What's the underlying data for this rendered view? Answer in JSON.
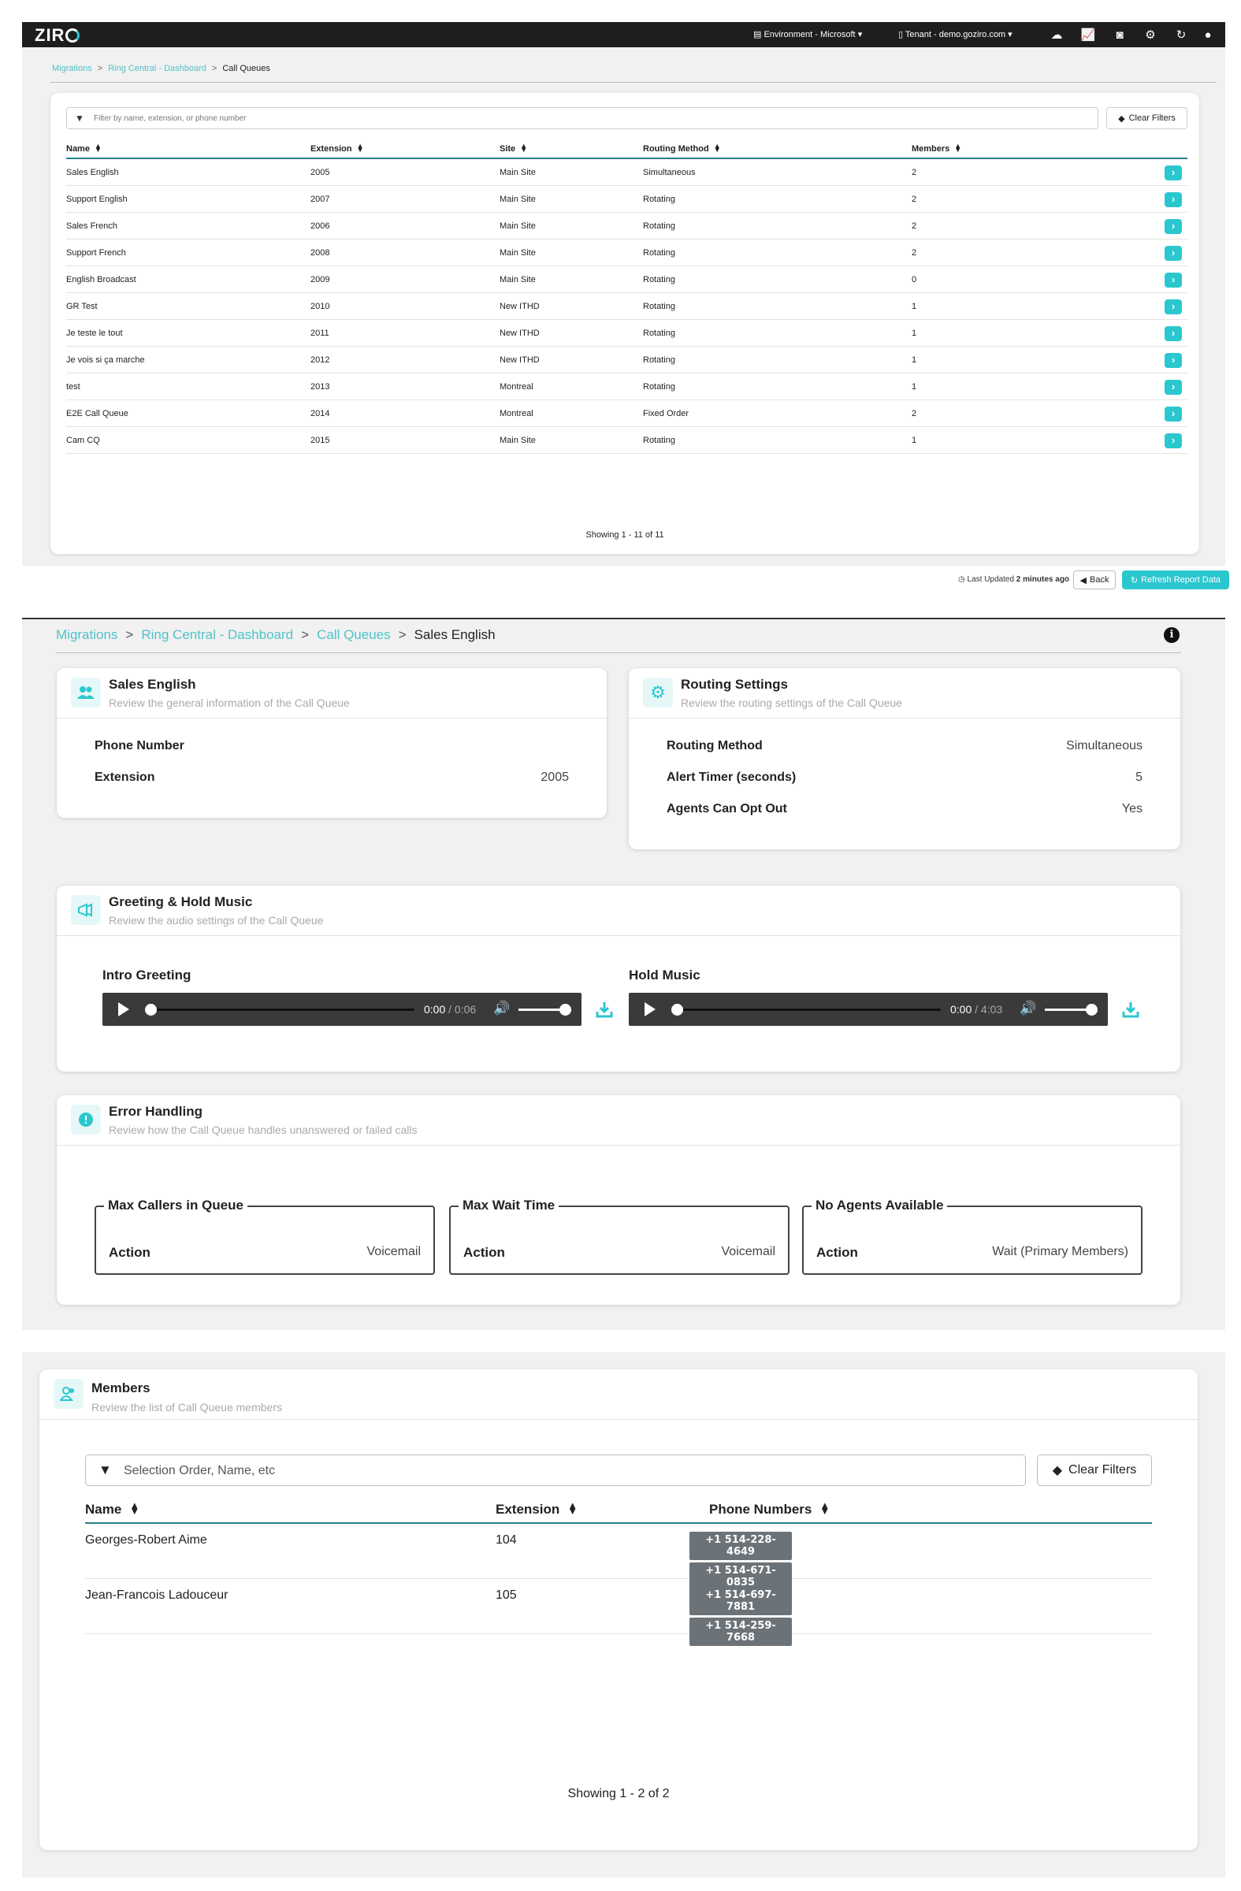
{
  "app": {
    "logo": "ZIR",
    "environment": "Environment - Microsoft",
    "tenant": "Tenant - demo.goziro.com"
  },
  "list_view": {
    "breadcrumb": [
      "Migrations",
      "Ring Central - Dashboard",
      "Call Queues"
    ],
    "filter_placeholder": "Filter by name, extension, or phone number",
    "clear_filters": "Clear Filters",
    "columns": [
      "Name",
      "Extension",
      "Site",
      "Routing Method",
      "Members"
    ],
    "rows": [
      [
        "Sales English",
        "2005",
        "Main Site",
        "Simultaneous",
        "2"
      ],
      [
        "Support English",
        "2007",
        "Main Site",
        "Rotating",
        "2"
      ],
      [
        "Sales French",
        "2006",
        "Main Site",
        "Rotating",
        "2"
      ],
      [
        "Support French",
        "2008",
        "Main Site",
        "Rotating",
        "2"
      ],
      [
        "English Broadcast",
        "2009",
        "Main Site",
        "Rotating",
        "0"
      ],
      [
        "GR Test",
        "2010",
        "New ITHD",
        "Rotating",
        "1"
      ],
      [
        "Je teste le tout",
        "2011",
        "New ITHD",
        "Rotating",
        "1"
      ],
      [
        "Je vois si ça marche",
        "2012",
        "New ITHD",
        "Rotating",
        "1"
      ],
      [
        "test",
        "2013",
        "Montreal",
        "Rotating",
        "1"
      ],
      [
        "E2E Call Queue",
        "2014",
        "Montreal",
        "Fixed Order",
        "2"
      ],
      [
        "Cam CQ",
        "2015",
        "Main Site",
        "Rotating",
        "1"
      ]
    ],
    "showing": "Showing 1 - 11 of 11",
    "last_updated_prefix": "Last Updated",
    "last_updated_value": "2 minutes ago",
    "back": "Back",
    "refresh": "Refresh Report Data"
  },
  "detail_view": {
    "breadcrumb": [
      "Migrations",
      "Ring Central - Dashboard",
      "Call Queues",
      "Sales English"
    ],
    "info_icon": "i",
    "general": {
      "title": "Sales English",
      "subtitle": "Review the general information of the Call Queue",
      "phone_label": "Phone Number",
      "phone_value": "",
      "extension_label": "Extension",
      "extension_value": "2005"
    },
    "routing": {
      "title": "Routing Settings",
      "subtitle": "Review the routing settings of the Call Queue",
      "method_label": "Routing Method",
      "method_value": "Simultaneous",
      "alert_label": "Alert Timer (seconds)",
      "alert_value": "5",
      "optout_label": "Agents Can Opt Out",
      "optout_value": "Yes"
    },
    "audio": {
      "title": "Greeting & Hold Music",
      "subtitle": "Review the audio settings of the Call Queue",
      "intro_label": "Intro Greeting",
      "intro_time": "0:00",
      "intro_duration": "0:06",
      "hold_label": "Hold Music",
      "hold_time": "0:00",
      "hold_duration": "4:03"
    },
    "errors": {
      "title": "Error Handling",
      "subtitle": "Review how the Call Queue handles unanswered or failed calls",
      "boxes": [
        {
          "legend": "Max Callers in Queue",
          "action_label": "Action",
          "action_value": "Voicemail"
        },
        {
          "legend": "Max Wait Time",
          "action_label": "Action",
          "action_value": "Voicemail"
        },
        {
          "legend": "No Agents Available",
          "action_label": "Action",
          "action_value": "Wait (Primary Members)"
        }
      ]
    }
  },
  "members_view": {
    "title": "Members",
    "subtitle": "Review the list of Call Queue members",
    "filter_placeholder": "Selection Order, Name, etc",
    "clear_filters": "Clear Filters",
    "columns": [
      "Name",
      "Extension",
      "Phone Numbers"
    ],
    "rows": [
      {
        "name": "Georges-Robert Aime",
        "extension": "104",
        "phones": [
          "+1 514-228-4649",
          "+1 514-671-0835"
        ]
      },
      {
        "name": "Jean-Francois Ladouceur",
        "extension": "105",
        "phones": [
          "+1 514-697-7881",
          "+1 514-259-7668"
        ]
      }
    ],
    "showing": "Showing 1 - 2 of 2"
  },
  "colors": {
    "accent": "#2bc7cf",
    "header_rule": "#2a7f86",
    "topbar": "#1e1e1e",
    "phone_badge": "#6c7378"
  }
}
